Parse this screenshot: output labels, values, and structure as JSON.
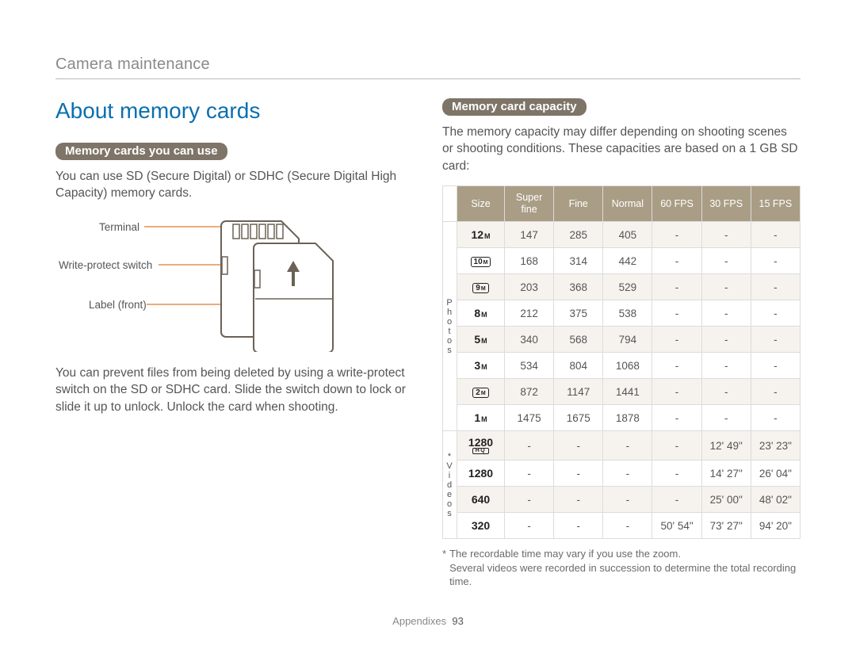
{
  "header": {
    "breadcrumb": "Camera maintenance"
  },
  "left": {
    "title": "About memory cards",
    "pill1": "Memory cards you can use",
    "p1": "You can use SD (Secure Digital) or SDHC (Secure Digital High Capacity) memory cards.",
    "callouts": {
      "terminal": "Terminal",
      "wps": "Write-protect switch",
      "label": "Label (front)"
    },
    "p2": "You can prevent files from being deleted by using a write-protect switch on the SD or SDHC card. Slide the switch down to lock or slide it up to unlock. Unlock the card when shooting."
  },
  "right": {
    "pill2": "Memory card capacity",
    "intro": "The memory capacity may differ depending on shooting scenes or shooting conditions. These capacities are based on a 1 GB SD card:"
  },
  "table": {
    "headers": [
      "Size",
      "Super fine",
      "Fine",
      "Normal",
      "60 FPS",
      "30 FPS",
      "15 FPS"
    ],
    "groups": [
      {
        "label": "P\nh\no\nt\no\ns",
        "rows": [
          {
            "size_num": "12",
            "size_m": "M",
            "box": false,
            "cells": [
              "147",
              "285",
              "405",
              "-",
              "-",
              "-"
            ]
          },
          {
            "size_num": "10",
            "size_m": "M",
            "box": true,
            "cells": [
              "168",
              "314",
              "442",
              "-",
              "-",
              "-"
            ]
          },
          {
            "size_num": "9",
            "size_m": "M",
            "box": true,
            "cells": [
              "203",
              "368",
              "529",
              "-",
              "-",
              "-"
            ]
          },
          {
            "size_num": "8",
            "size_m": "M",
            "box": false,
            "cells": [
              "212",
              "375",
              "538",
              "-",
              "-",
              "-"
            ]
          },
          {
            "size_num": "5",
            "size_m": "M",
            "box": false,
            "cells": [
              "340",
              "568",
              "794",
              "-",
              "-",
              "-"
            ]
          },
          {
            "size_num": "3",
            "size_m": "M",
            "box": false,
            "cells": [
              "534",
              "804",
              "1068",
              "-",
              "-",
              "-"
            ]
          },
          {
            "size_num": "2",
            "size_m": "M",
            "box": true,
            "cells": [
              "872",
              "1147",
              "1441",
              "-",
              "-",
              "-"
            ]
          },
          {
            "size_num": "1",
            "size_m": "M",
            "box": false,
            "cells": [
              "1475",
              "1675",
              "1878",
              "-",
              "-",
              "-"
            ]
          }
        ]
      },
      {
        "label": "*\nV\ni\nd\ne\no\ns",
        "rows": [
          {
            "size_num": "1280",
            "hq": true,
            "cells": [
              "-",
              "-",
              "-",
              "-",
              "12' 49\"",
              "23' 23\""
            ]
          },
          {
            "size_num": "1280",
            "hq": false,
            "cells": [
              "-",
              "-",
              "-",
              "-",
              "14' 27\"",
              "26' 04\""
            ]
          },
          {
            "size_num": "640",
            "hq": false,
            "cells": [
              "-",
              "-",
              "-",
              "-",
              "25' 00\"",
              "48' 02\""
            ]
          },
          {
            "size_num": "320",
            "hq": false,
            "cells": [
              "-",
              "-",
              "-",
              "50' 54\"",
              "73' 27\"",
              "94' 20\""
            ]
          }
        ]
      }
    ],
    "footnote_star": "*",
    "footnote": "The recordable time may vary if you use the zoom.\nSeveral videos were recorded in succession to determine the total recording time."
  },
  "footer": {
    "section": "Appendixes",
    "page": "93"
  },
  "chart_data": {
    "type": "table",
    "title": "Memory card capacity (1 GB SD card)",
    "columns": [
      "Size",
      "Super fine",
      "Fine",
      "Normal",
      "60 FPS",
      "30 FPS",
      "15 FPS"
    ],
    "rows": [
      [
        "12M",
        147,
        285,
        405,
        null,
        null,
        null
      ],
      [
        "10M",
        168,
        314,
        442,
        null,
        null,
        null
      ],
      [
        "9M",
        203,
        368,
        529,
        null,
        null,
        null
      ],
      [
        "8M",
        212,
        375,
        538,
        null,
        null,
        null
      ],
      [
        "5M",
        340,
        568,
        794,
        null,
        null,
        null
      ],
      [
        "3M",
        534,
        804,
        1068,
        null,
        null,
        null
      ],
      [
        "2M",
        872,
        1147,
        1441,
        null,
        null,
        null
      ],
      [
        "1M",
        1475,
        1675,
        1878,
        null,
        null,
        null
      ],
      [
        "1280 HQ",
        null,
        null,
        null,
        null,
        "12' 49\"",
        "23' 23\""
      ],
      [
        "1280",
        null,
        null,
        null,
        null,
        "14' 27\"",
        "26' 04\""
      ],
      [
        "640",
        null,
        null,
        null,
        null,
        "25' 00\"",
        "48' 02\""
      ],
      [
        "320",
        null,
        null,
        null,
        "50' 54\"",
        "73' 27\"",
        "94' 20\""
      ]
    ]
  }
}
